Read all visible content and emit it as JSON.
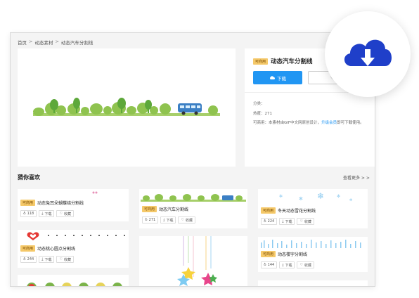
{
  "breadcrumb": [
    "首页",
    "动态素材",
    "动态汽车分割线"
  ],
  "breadcrumb_sep": ">",
  "detail": {
    "tag": "可商用",
    "title": "动态汽车分割线",
    "download_label": "下载",
    "category_label": "分类：",
    "heat_label": "热度：",
    "heat_value": "271",
    "license_prefix": "可商用：本素材由GIF中文网原创设计，",
    "license_link": "升级会员",
    "license_suffix": "即可下载使用。"
  },
  "section": {
    "title": "猜你喜欢",
    "more": "查看更多 > >"
  },
  "cards": [
    {
      "tag": "可商用",
      "name": "动态兔耳朵蝴蝶结分割线",
      "likes": "118",
      "download": "下载",
      "fav": "收藏"
    },
    {
      "tag": "可商用",
      "name": "动态汽车分割线",
      "likes": "271",
      "download": "下载",
      "fav": "收藏"
    },
    {
      "tag": "可商用",
      "name": "冬天动态雪花分割线",
      "likes": "224",
      "download": "下载",
      "fav": "收藏"
    },
    {
      "tag": "可商用",
      "name": "动态桃心圆点分割线",
      "likes": "244",
      "download": "下载",
      "fav": "收藏"
    },
    {
      "tag": "可商用",
      "name": "动态楼宇分割线",
      "likes": "144",
      "download": "下载",
      "fav": "收藏"
    }
  ],
  "colors": {
    "accent": "#2196f3",
    "tag_bg": "#f5c96a",
    "cloud_icon": "#1f3fc9"
  },
  "icons": [
    "cloud-download-icon",
    "heart-icon",
    "like-icon",
    "download-icon"
  ]
}
